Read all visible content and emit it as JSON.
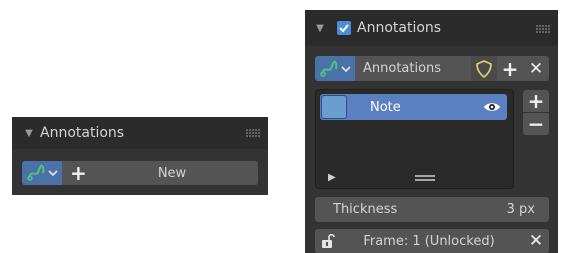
{
  "colors": {
    "panel_bg": "#333333",
    "header_bg": "#2b2b2b",
    "accent_blue": "#5a80c2",
    "swatch": "#6b9ed0",
    "icon_green": "#4fc47a",
    "shield_yellow": "#e2d27a"
  },
  "left_panel": {
    "title": "Annotations",
    "new_button_label": "New",
    "icons": [
      "disclosure-triangle",
      "annotate-stroke-icon",
      "dropdown-chevron",
      "plus-icon",
      "drag-grip"
    ]
  },
  "right_panel": {
    "title": "Annotations",
    "enabled_checkbox": true,
    "datablock_name": "Annotations",
    "layers": [
      {
        "name": "Note",
        "visible": true,
        "selected": true
      }
    ],
    "thickness_label": "Thickness",
    "thickness_value": "3 px",
    "frame_label": "Frame: 1 (Unlocked)",
    "icons": [
      "disclosure-triangle",
      "checkbox-check",
      "annotate-stroke-icon",
      "dropdown-chevron",
      "shield-icon",
      "plus-icon",
      "close-icon",
      "eye-icon",
      "minus-icon",
      "play-triangle",
      "resize-handle",
      "unlock-icon"
    ]
  }
}
